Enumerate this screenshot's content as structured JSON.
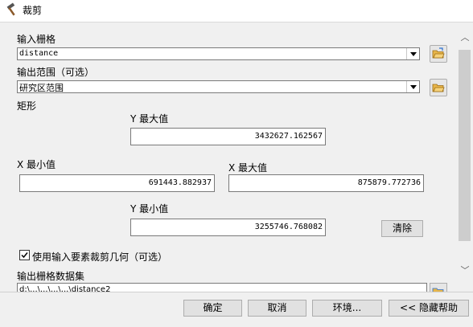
{
  "window": {
    "title": "裁剪",
    "icon": "hammer-icon"
  },
  "fields": {
    "input_raster": {
      "label": "输入栅格",
      "value": "distance"
    },
    "output_extent": {
      "label": "输出范围（可选）",
      "value": "研究区范围"
    },
    "rectangle": {
      "label": "矩形",
      "y_max_label": "Y 最大值",
      "y_max": "3432627.162567",
      "x_min_label": "X 最小值",
      "x_min": "691443.882937",
      "x_max_label": "X 最大值",
      "x_max": "875879.772736",
      "y_min_label": "Y 最小值",
      "y_min": "3255746.768082",
      "clear_label": "清除"
    },
    "use_features_geometry": {
      "label": "使用输入要素裁剪几何（可选）",
      "checked": true
    },
    "output_raster": {
      "label": "输出栅格数据集",
      "value": "d:\\...\\...\\...\\...\\distance2"
    }
  },
  "buttons": {
    "ok": "确定",
    "cancel": "取消",
    "environments": "环境...",
    "hide_help": "<< 隐藏帮助"
  },
  "icons": [
    "hammer-icon",
    "folder-open-icon",
    "checkmark-icon",
    "chevron-up-icon",
    "chevron-down-icon",
    "dropdown-arrow-icon"
  ]
}
